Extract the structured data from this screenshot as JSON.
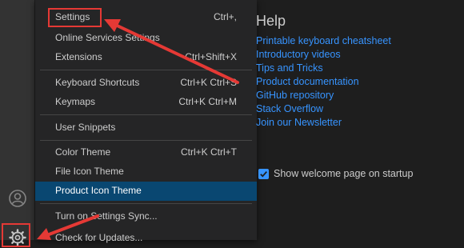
{
  "menu": {
    "items": [
      {
        "label": "Settings",
        "key": "Ctrl+,"
      },
      {
        "label": "Online Services Settings",
        "key": ""
      },
      {
        "label": "Extensions",
        "key": "Ctrl+Shift+X"
      },
      {
        "label": "Keyboard Shortcuts",
        "key": "Ctrl+K Ctrl+S"
      },
      {
        "label": "Keymaps",
        "key": "Ctrl+K Ctrl+M"
      },
      {
        "label": "User Snippets",
        "key": ""
      },
      {
        "label": "Color Theme",
        "key": "Ctrl+K Ctrl+T"
      },
      {
        "label": "File Icon Theme",
        "key": ""
      },
      {
        "label": "Product Icon Theme",
        "key": ""
      },
      {
        "label": "Turn on Settings Sync...",
        "key": ""
      },
      {
        "label": "Check for Updates...",
        "key": ""
      }
    ],
    "active": "Product Icon Theme"
  },
  "help": {
    "title": "Help",
    "links": [
      "Printable keyboard cheatsheet",
      "Introductory videos",
      "Tips and Tricks",
      "Product documentation",
      "GitHub repository",
      "Stack Overflow",
      "Join our Newsletter"
    ]
  },
  "startup": {
    "label": "Show welcome page on startup",
    "checked": true
  },
  "icons": {
    "account": "account-icon",
    "manage": "gear-icon",
    "checkbox": "checkmark-icon"
  },
  "colors": {
    "highlight": "#e53935",
    "link": "#3794ff",
    "menu_selection": "#094771"
  }
}
